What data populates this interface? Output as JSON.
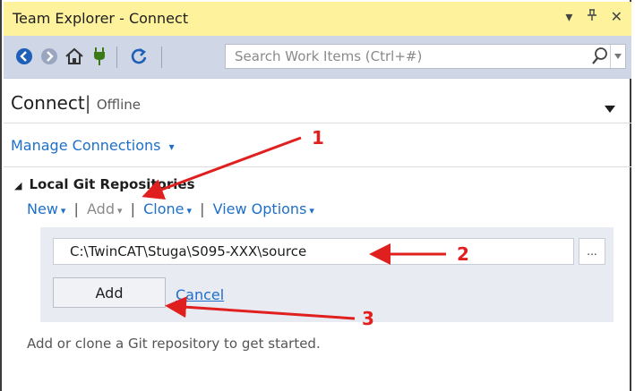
{
  "window": {
    "title": "Team Explorer - Connect",
    "controls": [
      "▾",
      "⊥",
      "✕"
    ]
  },
  "toolbar": {
    "search_placeholder": "Search Work Items (Ctrl+#)",
    "icons": [
      "back-icon",
      "forward-icon",
      "home-icon",
      "plug-icon",
      "refresh-icon",
      "search-icon"
    ]
  },
  "header": {
    "title": "Connect",
    "separator": "|",
    "status": "Offline"
  },
  "manage": {
    "label": "Manage Connections",
    "caret": "▾"
  },
  "section": {
    "title": "Local Git Repositories",
    "toggle": "◢"
  },
  "actions": {
    "new_label": "New",
    "add_label": "Add",
    "clone_label": "Clone",
    "view_options_label": "View Options",
    "caret": "▾",
    "pipe": "|"
  },
  "add_panel": {
    "path_value": "C:\\TwinCAT\\Stuga\\S095-XXX\\source",
    "browse_label": "...",
    "add_button": "Add",
    "cancel_link": "Cancel"
  },
  "hint": "Add or clone a Git repository to get started.",
  "annotations": {
    "num1": "1",
    "num2": "2",
    "num3": "3",
    "color": "#e0201f"
  },
  "colors": {
    "titlebar": "#fff29d",
    "toolbar": "#cfd6e5",
    "link": "#1e6fc9",
    "panel": "#e8ebf1"
  }
}
